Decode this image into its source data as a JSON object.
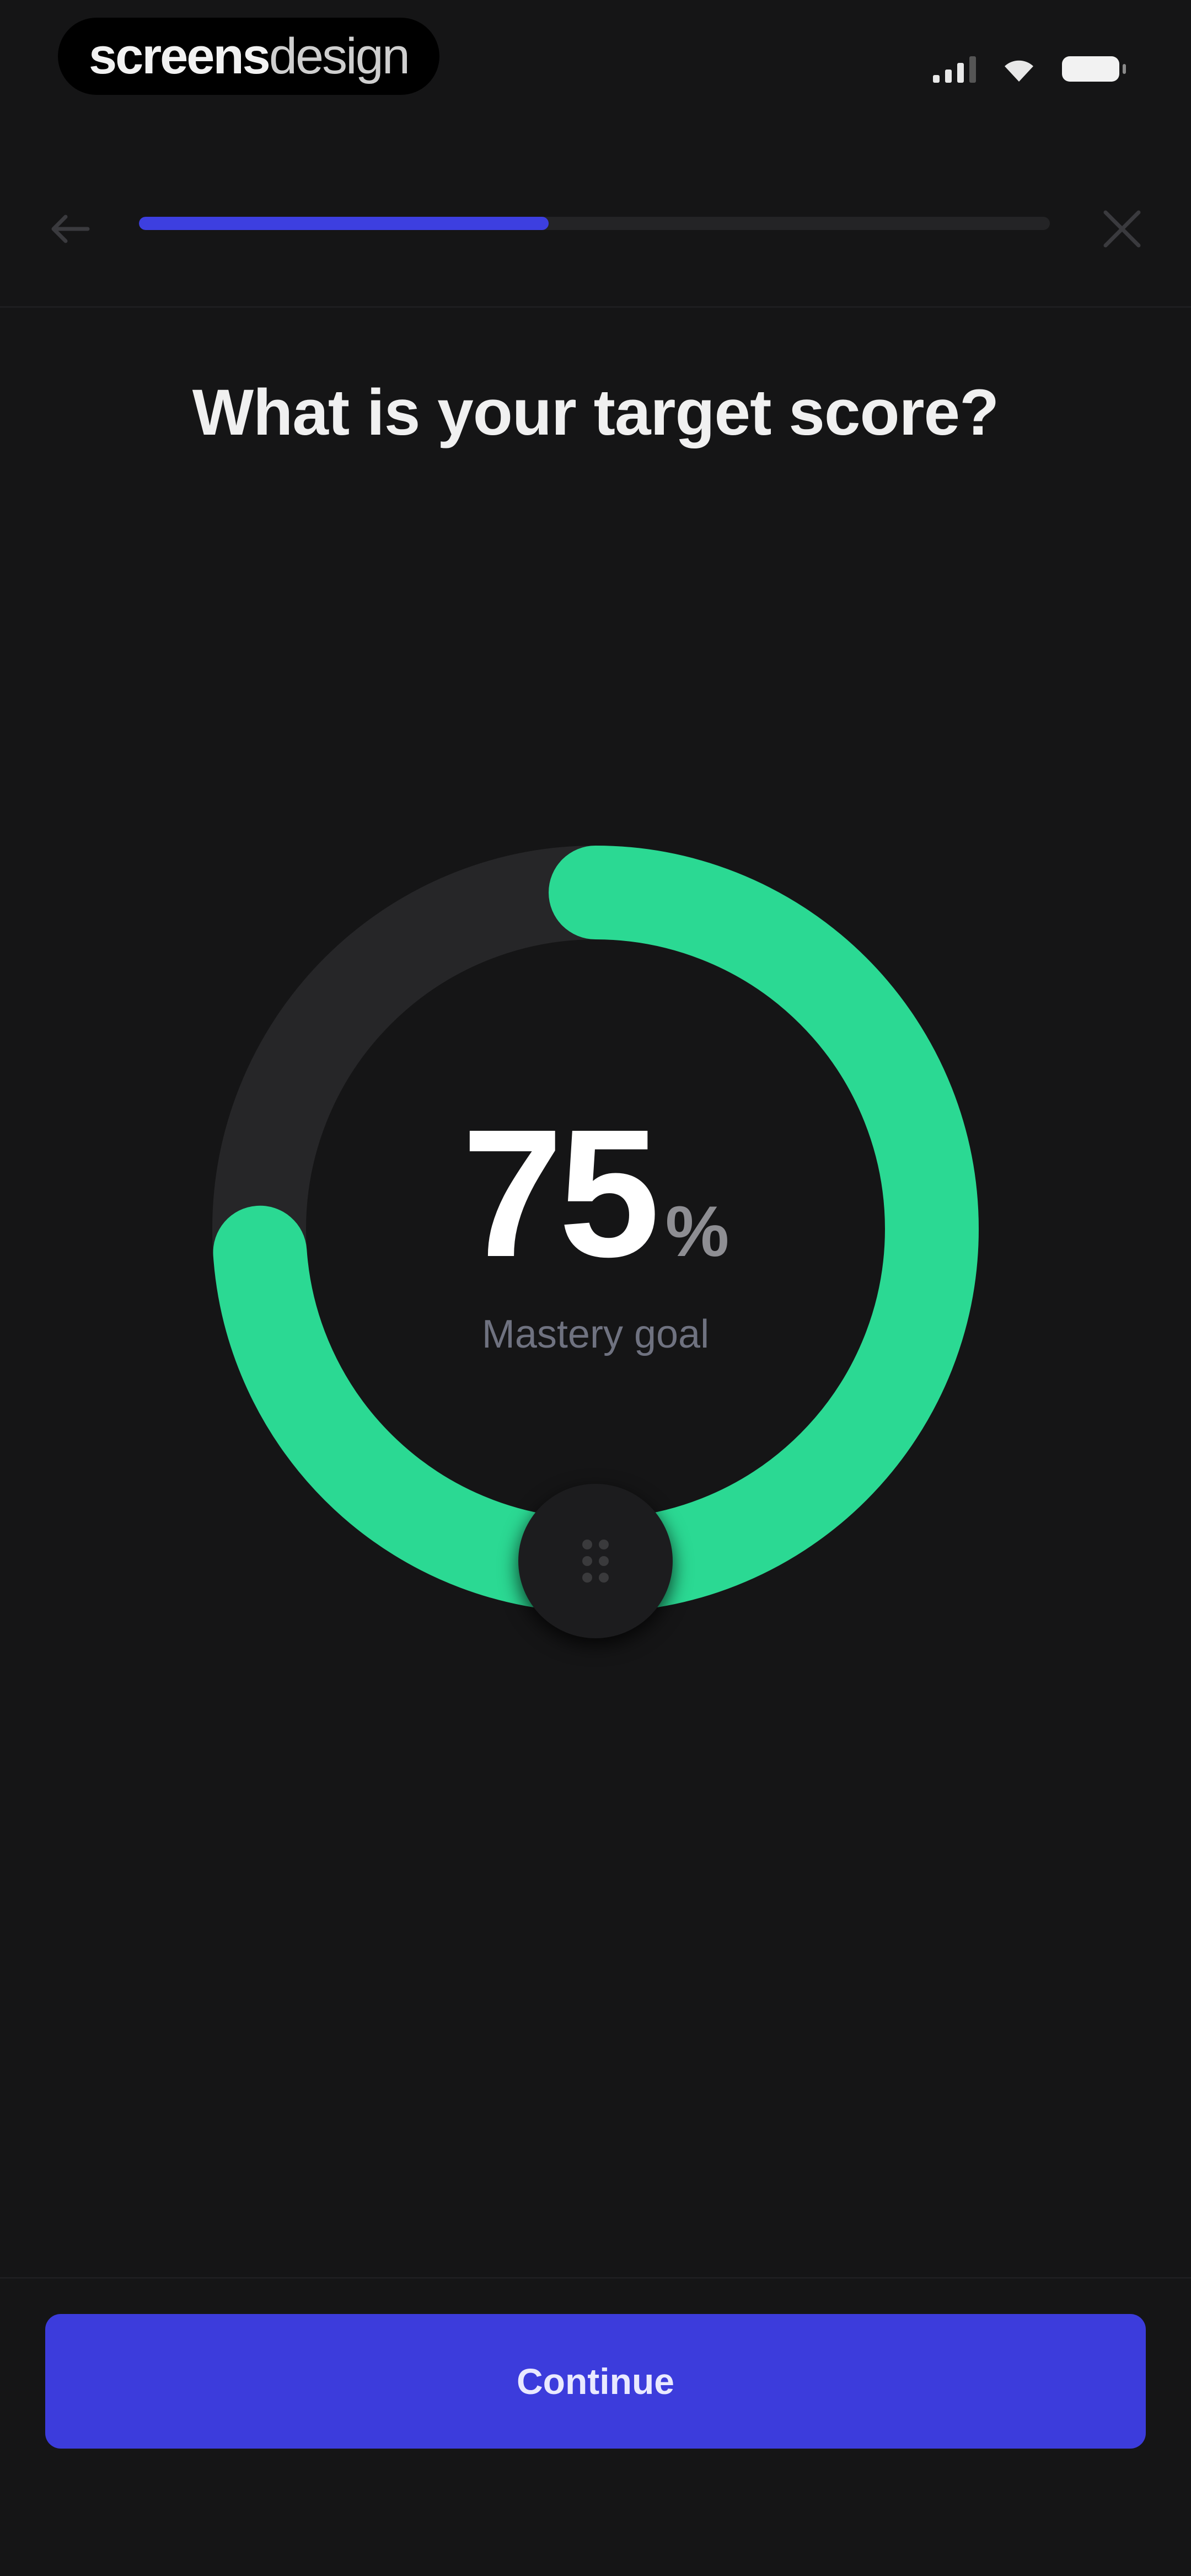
{
  "status_bar": {
    "brand_bold": "screens",
    "brand_light": "design",
    "icons": [
      "cellular-signal-icon",
      "wifi-icon",
      "battery-icon"
    ]
  },
  "nav": {
    "back_icon": "arrow-left-icon",
    "close_icon": "close-icon",
    "progress_fraction": 0.45
  },
  "question": {
    "title": "What is your target score?"
  },
  "dial": {
    "value": "75",
    "unit": "%",
    "caption": "Mastery goal",
    "percent": 75,
    "handle_icon": "drag-grip-icon"
  },
  "footer": {
    "continue_label": "Continue"
  },
  "colors": {
    "background": "#151516",
    "accent": "#3c3cdc",
    "progress": "#3d3fe0",
    "dial_fill": "#2bd993",
    "dial_track": "#262628",
    "muted_text": "#6f7280"
  }
}
